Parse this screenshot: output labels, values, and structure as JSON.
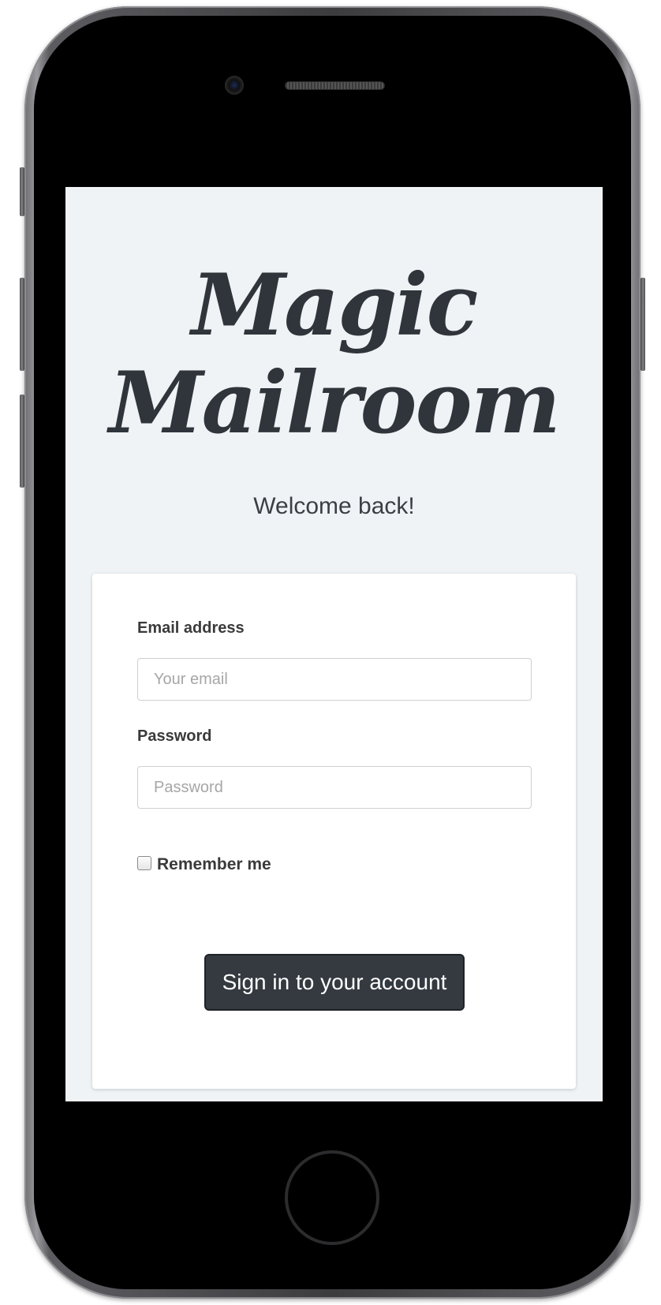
{
  "app": {
    "logo_line1": "Magic",
    "logo_line2": "Mailroom",
    "welcome": "Welcome back!"
  },
  "form": {
    "email_label": "Email address",
    "email_placeholder": "Your email",
    "email_value": "",
    "password_label": "Password",
    "password_placeholder": "Password",
    "password_value": "",
    "remember_label": "Remember me",
    "remember_checked": false,
    "submit_label": "Sign in to your account"
  },
  "colors": {
    "screen_background": "#eff3f6",
    "card_background": "#ffffff",
    "button_background": "#343a40",
    "logo_text": "#2f353b"
  },
  "icons": {
    "camera": "front-camera-icon",
    "speaker": "earpiece-speaker-icon",
    "home": "home-button-icon"
  }
}
